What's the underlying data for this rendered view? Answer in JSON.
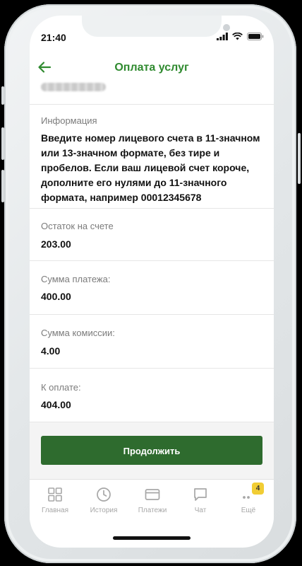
{
  "status": {
    "time": "21:40"
  },
  "header": {
    "title": "Оплата услуг"
  },
  "info": {
    "label": "Информация",
    "text": "Введите номер лицевого счета в 11-значном или 13-значном формате, без тире и пробелов. Если ваш лицевой счет короче, дополните его нулями до 11-значного формата, например 00012345678"
  },
  "balance": {
    "label": "Остаток на счете",
    "value": "203.00"
  },
  "payment": {
    "label": "Сумма платежа:",
    "value": "400.00"
  },
  "commission": {
    "label": "Сумма комиссии:",
    "value": "4.00"
  },
  "total": {
    "label": "К оплате:",
    "value": "404.00"
  },
  "continue_label": "Продолжить",
  "tabs": [
    {
      "label": "Главная",
      "icon": "grid-icon"
    },
    {
      "label": "История",
      "icon": "clock-icon"
    },
    {
      "label": "Платежи",
      "icon": "card-icon"
    },
    {
      "label": "Чат",
      "icon": "chat-icon"
    },
    {
      "label": "Ещё",
      "icon": "more-icon",
      "badge": "4"
    }
  ],
  "colors": {
    "accent": "#2f8a2f",
    "button": "#2e6b2e",
    "badge": "#f1cd34"
  }
}
